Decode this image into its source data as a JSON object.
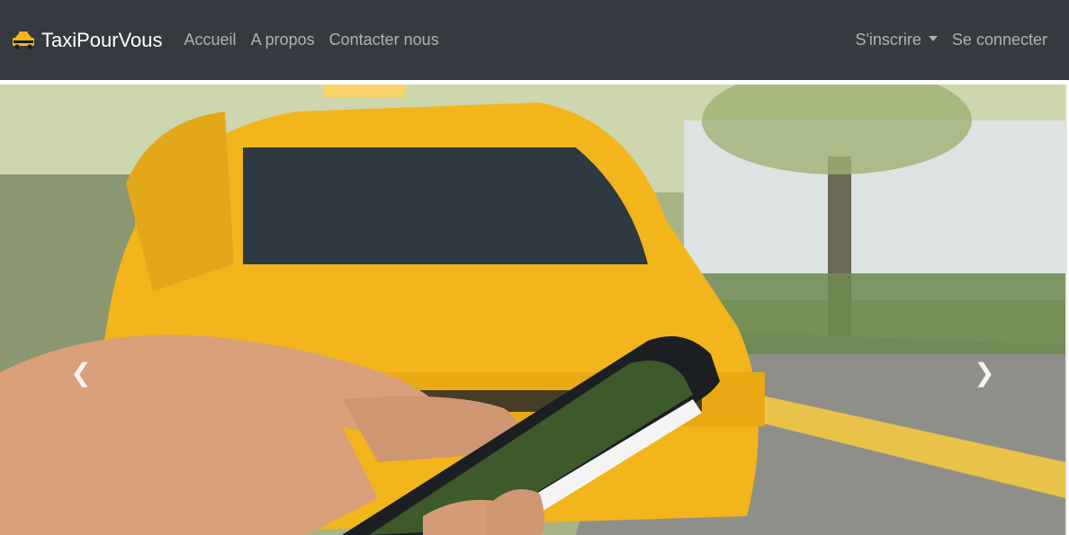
{
  "navbar": {
    "brand": "TaxiPourVous",
    "brand_icon": "taxi-icon",
    "links": [
      {
        "label": "Accueil"
      },
      {
        "label": "A propos"
      },
      {
        "label": "Contacter nous"
      }
    ],
    "register_label": "S'inscrire",
    "login_label": "Se connecter"
  },
  "carousel": {
    "prev_icon": "chevron-left-icon",
    "next_icon": "chevron-right-icon"
  },
  "colors": {
    "navbar_bg": "#343a40",
    "taxi_yellow": "#f2b51b"
  }
}
